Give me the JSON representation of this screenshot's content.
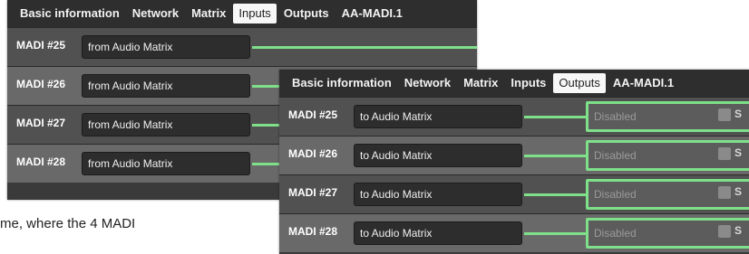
{
  "panel_inputs": {
    "tabs": [
      "Basic information",
      "Network",
      "Matrix",
      "Inputs",
      "Outputs",
      "AA-MADI.1"
    ],
    "active_tab": "Inputs",
    "rows": [
      {
        "label": "MADI #25",
        "source": "from Audio Matrix"
      },
      {
        "label": "MADI #26",
        "source": "from Audio Matrix"
      },
      {
        "label": "MADI #27",
        "source": "from Audio Matrix"
      },
      {
        "label": "MADI #28",
        "source": "from Audio Matrix"
      }
    ]
  },
  "panel_outputs": {
    "tabs": [
      "Basic information",
      "Network",
      "Matrix",
      "Inputs",
      "Outputs",
      "AA-MADI.1"
    ],
    "active_tab": "Outputs",
    "rows": [
      {
        "label": "MADI #25",
        "source": "to Audio Matrix",
        "dest": "Disabled",
        "suffix": "S"
      },
      {
        "label": "MADI #26",
        "source": "to Audio Matrix",
        "dest": "Disabled",
        "suffix": "S"
      },
      {
        "label": "MADI #27",
        "source": "to Audio Matrix",
        "dest": "Disabled",
        "suffix": "S"
      },
      {
        "label": "MADI #28",
        "source": "to Audio Matrix",
        "dest": "Disabled",
        "suffix": "S"
      }
    ]
  },
  "caption": "me, where the 4 MADI",
  "colors": {
    "link_green": "#7fe08a",
    "panel_bg": "#3a3a3a",
    "active_tab_bg": "#f7f7f7"
  }
}
